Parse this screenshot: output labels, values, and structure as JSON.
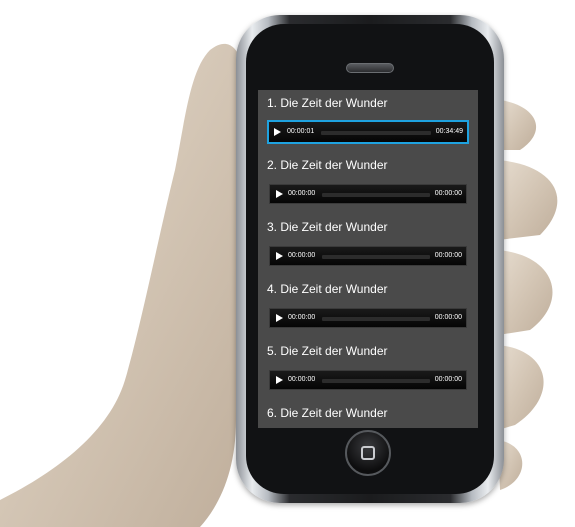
{
  "tracks": [
    {
      "title": "1. Die Zeit der Wunder",
      "current": "00:00:01",
      "duration": "00:34:49",
      "active": true
    },
    {
      "title": "2. Die Zeit der Wunder",
      "current": "00:00:00",
      "duration": "00:00:00",
      "active": false
    },
    {
      "title": "3. Die Zeit der Wunder",
      "current": "00:00:00",
      "duration": "00:00:00",
      "active": false
    },
    {
      "title": "4. Die Zeit der Wunder",
      "current": "00:00:00",
      "duration": "00:00:00",
      "active": false
    },
    {
      "title": "5. Die Zeit der Wunder",
      "current": "00:00:00",
      "duration": "00:00:00",
      "active": false
    },
    {
      "title": "6. Die Zeit der Wunder"
    }
  ],
  "colors": {
    "accent": "#1ea2e0",
    "screen_bg": "#4a4a4a"
  },
  "icons": {
    "play": "play-icon",
    "home": "home-button-icon"
  }
}
